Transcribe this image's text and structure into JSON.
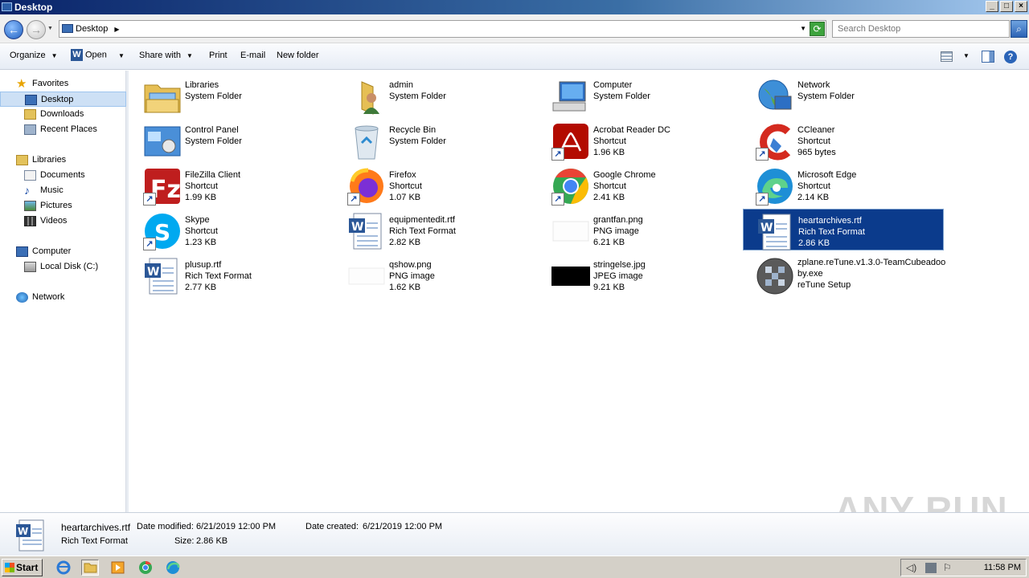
{
  "window": {
    "title": "Desktop",
    "controls": [
      "_",
      "□",
      "×"
    ]
  },
  "address": {
    "location": "Desktop",
    "search_placeholder": "Search Desktop"
  },
  "toolbar": {
    "organize": "Organize",
    "open": "Open",
    "share_with": "Share with",
    "print": "Print",
    "email": "E-mail",
    "new_folder": "New folder"
  },
  "nav": {
    "favorites": "Favorites",
    "desktop": "Desktop",
    "downloads": "Downloads",
    "recent_places": "Recent Places",
    "libraries": "Libraries",
    "documents": "Documents",
    "music": "Music",
    "pictures": "Pictures",
    "videos": "Videos",
    "computer": "Computer",
    "local_disk": "Local Disk (C:)",
    "network": "Network"
  },
  "items": [
    {
      "name": "Libraries",
      "type": "System Folder",
      "size": "",
      "icon": "libraries-icon"
    },
    {
      "name": "admin",
      "type": "System Folder",
      "size": "",
      "icon": "user-folder-icon"
    },
    {
      "name": "Computer",
      "type": "System Folder",
      "size": "",
      "icon": "computer-icon"
    },
    {
      "name": "Network",
      "type": "System Folder",
      "size": "",
      "icon": "network-icon"
    },
    {
      "name": "Control Panel",
      "type": "System Folder",
      "size": "",
      "icon": "control-panel-icon"
    },
    {
      "name": "Recycle Bin",
      "type": "System Folder",
      "size": "",
      "icon": "recycle-bin-icon"
    },
    {
      "name": "Acrobat Reader DC",
      "type": "Shortcut",
      "size": "1.96 KB",
      "icon": "acrobat-icon"
    },
    {
      "name": "CCleaner",
      "type": "Shortcut",
      "size": "965 bytes",
      "icon": "ccleaner-icon"
    },
    {
      "name": "FileZilla Client",
      "type": "Shortcut",
      "size": "1.99 KB",
      "icon": "filezilla-icon"
    },
    {
      "name": "Firefox",
      "type": "Shortcut",
      "size": "1.07 KB",
      "icon": "firefox-icon"
    },
    {
      "name": "Google Chrome",
      "type": "Shortcut",
      "size": "2.41 KB",
      "icon": "chrome-icon"
    },
    {
      "name": "Microsoft Edge",
      "type": "Shortcut",
      "size": "2.14 KB",
      "icon": "edge-icon"
    },
    {
      "name": "Skype",
      "type": "Shortcut",
      "size": "1.23 KB",
      "icon": "skype-icon"
    },
    {
      "name": "equipmentedit.rtf",
      "type": "Rich Text Format",
      "size": "2.82 KB",
      "icon": "rtf-document-icon"
    },
    {
      "name": "grantfan.png",
      "type": "PNG image",
      "size": "6.21 KB",
      "icon": "png-thumbnail-icon"
    },
    {
      "name": "heartarchives.rtf",
      "type": "Rich Text Format",
      "size": "2.86 KB",
      "icon": "rtf-document-icon"
    },
    {
      "name": "plusup.rtf",
      "type": "Rich Text Format",
      "size": "2.77 KB",
      "icon": "rtf-document-icon"
    },
    {
      "name": "qshow.png",
      "type": "PNG image",
      "size": "1.62 KB",
      "icon": "png-thumbnail-icon"
    },
    {
      "name": "stringelse.jpg",
      "type": "JPEG image",
      "size": "9.21 KB",
      "icon": "jpg-thumbnail-icon"
    },
    {
      "name": "zplane.reTune.v1.3.0-TeamCubeadoo",
      "name2": "by.exe",
      "type": "reTune Setup",
      "size": "",
      "icon": "exe-setup-icon"
    }
  ],
  "details": {
    "name": "heartarchives.rtf",
    "type": "Rich Text Format",
    "modified_label": "Date modified:",
    "modified": "6/21/2019 12:00 PM",
    "created_label": "Date created:",
    "created": "6/21/2019 12:00 PM",
    "size_label": "Size:",
    "size": "2.86 KB"
  },
  "watermark": "ANY RUN",
  "taskbar": {
    "start": "Start",
    "clock": "11:58 PM"
  },
  "colors": {
    "selection": "#0b3b8c",
    "titlebar": "#0a246a",
    "taskbar": "#d4d0c8"
  }
}
